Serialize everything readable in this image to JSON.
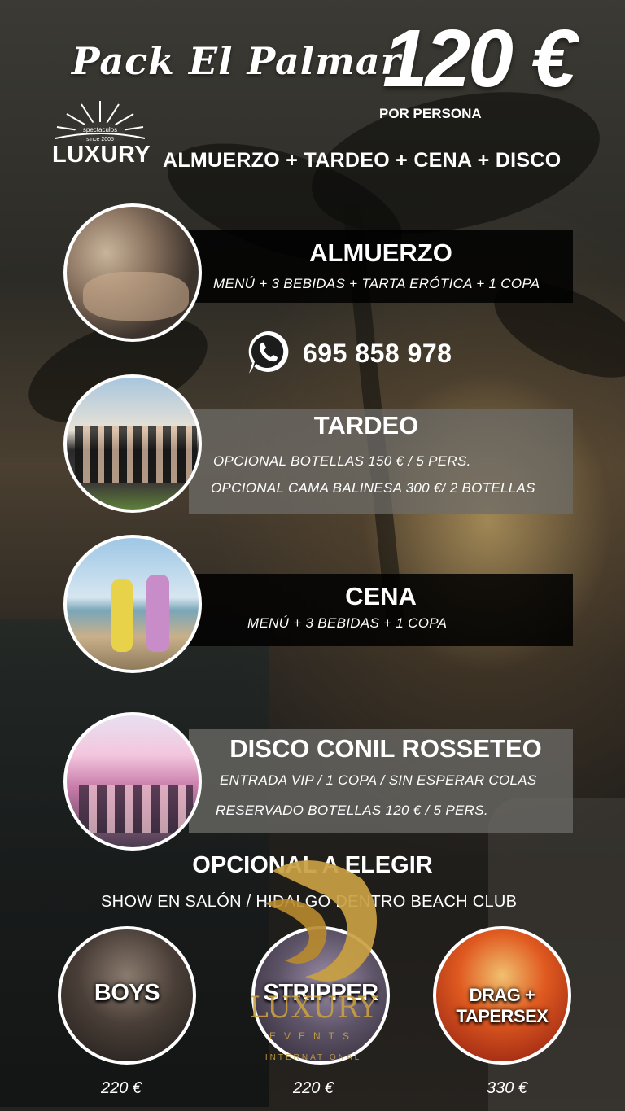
{
  "header": {
    "title": "Pack El Palmar",
    "price": "120 €",
    "price_note": "POR PERSONA",
    "logo_word": "LUXURY",
    "logo_arc": "spectaculos",
    "logo_since": "since 2005",
    "subtitle": "ALMUERZO + TARDEO + CENA + DISCO"
  },
  "contact": {
    "phone": "695 858 978",
    "icon": "whatsapp-icon"
  },
  "sections": [
    {
      "title": "ALMUERZO",
      "lines": [
        "MENÚ + 3 BEBIDAS + TARTA ERÓTICA + 1 COPA"
      ]
    },
    {
      "title": "TARDEO",
      "lines": [
        "OPCIONAL BOTELLAS 150 € / 5 PERS.",
        "OPCIONAL  CAMA BALINESA 300 €/ 2 BOTELLAS"
      ]
    },
    {
      "title": "CENA",
      "lines": [
        "MENÚ + 3 BEBIDAS + 1 COPA"
      ]
    },
    {
      "title": "DISCO CONIL ROSSETEO",
      "lines": [
        "ENTRADA VIP   / 1 COPA / SIN  ESPERAR COLAS",
        "RESERVADO BOTELLAS 120 € / 5 PERS."
      ]
    }
  ],
  "optional": {
    "title": "OPCIONAL A ELEGIR",
    "subtitle": "SHOW EN SALÓN / HIDALGO DENTRO BEACH CLUB",
    "shows": [
      {
        "label": "BOYS",
        "price": "220 €"
      },
      {
        "label": "STRIPPER",
        "price": "220 €"
      },
      {
        "label": "DRAG + TAPERSEX",
        "price": "330 €"
      }
    ]
  },
  "watermark": {
    "word": "LUXURY",
    "line1": "EVENTS",
    "line2": "INTERNATIONAL"
  },
  "colors": {
    "gold": "#c9a042",
    "band_dark": "#000000",
    "band_grey": "#6e6c68"
  }
}
